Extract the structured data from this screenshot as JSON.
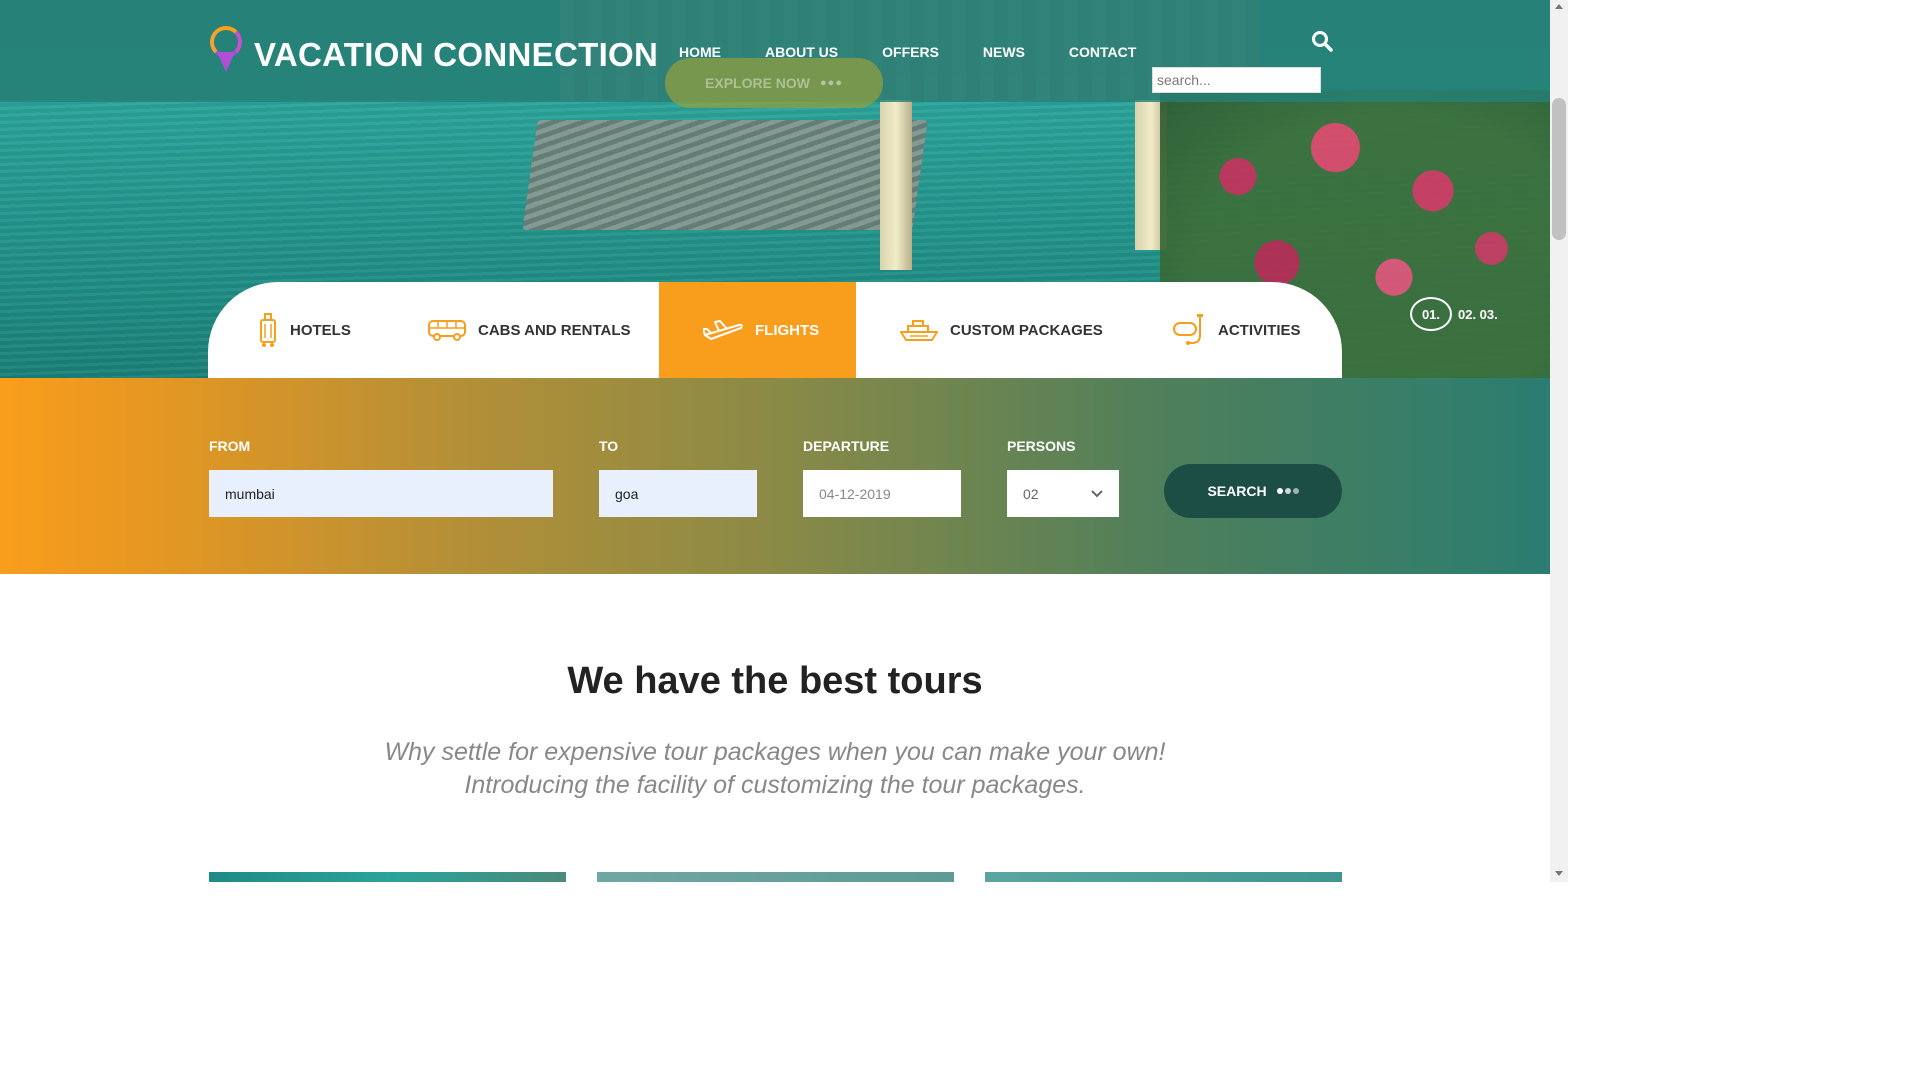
{
  "brand": {
    "name": "VACATION CONNECTION"
  },
  "nav": {
    "items": [
      "HOME",
      "ABOUT US",
      "OFFERS",
      "NEWS",
      "CONTACT"
    ]
  },
  "hero": {
    "cta_label": "EXPLORE NOW",
    "search_placeholder": "search...",
    "slides": {
      "active": "01.",
      "others": "02. 03."
    }
  },
  "tabs": [
    {
      "label": "HOTELS",
      "icon": "luggage-icon"
    },
    {
      "label": "CABS AND RENTALS",
      "icon": "bus-icon"
    },
    {
      "label": "FLIGHTS",
      "icon": "airplane-icon",
      "active": true
    },
    {
      "label": "CUSTOM PACKAGES",
      "icon": "ship-icon"
    },
    {
      "label": "ACTIVITIES",
      "icon": "snorkel-icon"
    }
  ],
  "booking": {
    "from": {
      "label": "FROM",
      "value": "mumbai"
    },
    "to": {
      "label": "TO",
      "value": "goa"
    },
    "departure": {
      "label": "DEPARTURE",
      "value": "04-12-2019"
    },
    "persons": {
      "label": "PERSONS",
      "value": "02"
    },
    "search_label": "SEARCH"
  },
  "section": {
    "title": "We have the best tours",
    "subtitle_line1": "Why settle for expensive tour packages when you can make your own!",
    "subtitle_line2": "Introducing the facility of customizing the tour packages."
  },
  "colors": {
    "accent": "#f99d1c",
    "teal": "#2a7d70",
    "dark_button": "#1c4e45"
  }
}
